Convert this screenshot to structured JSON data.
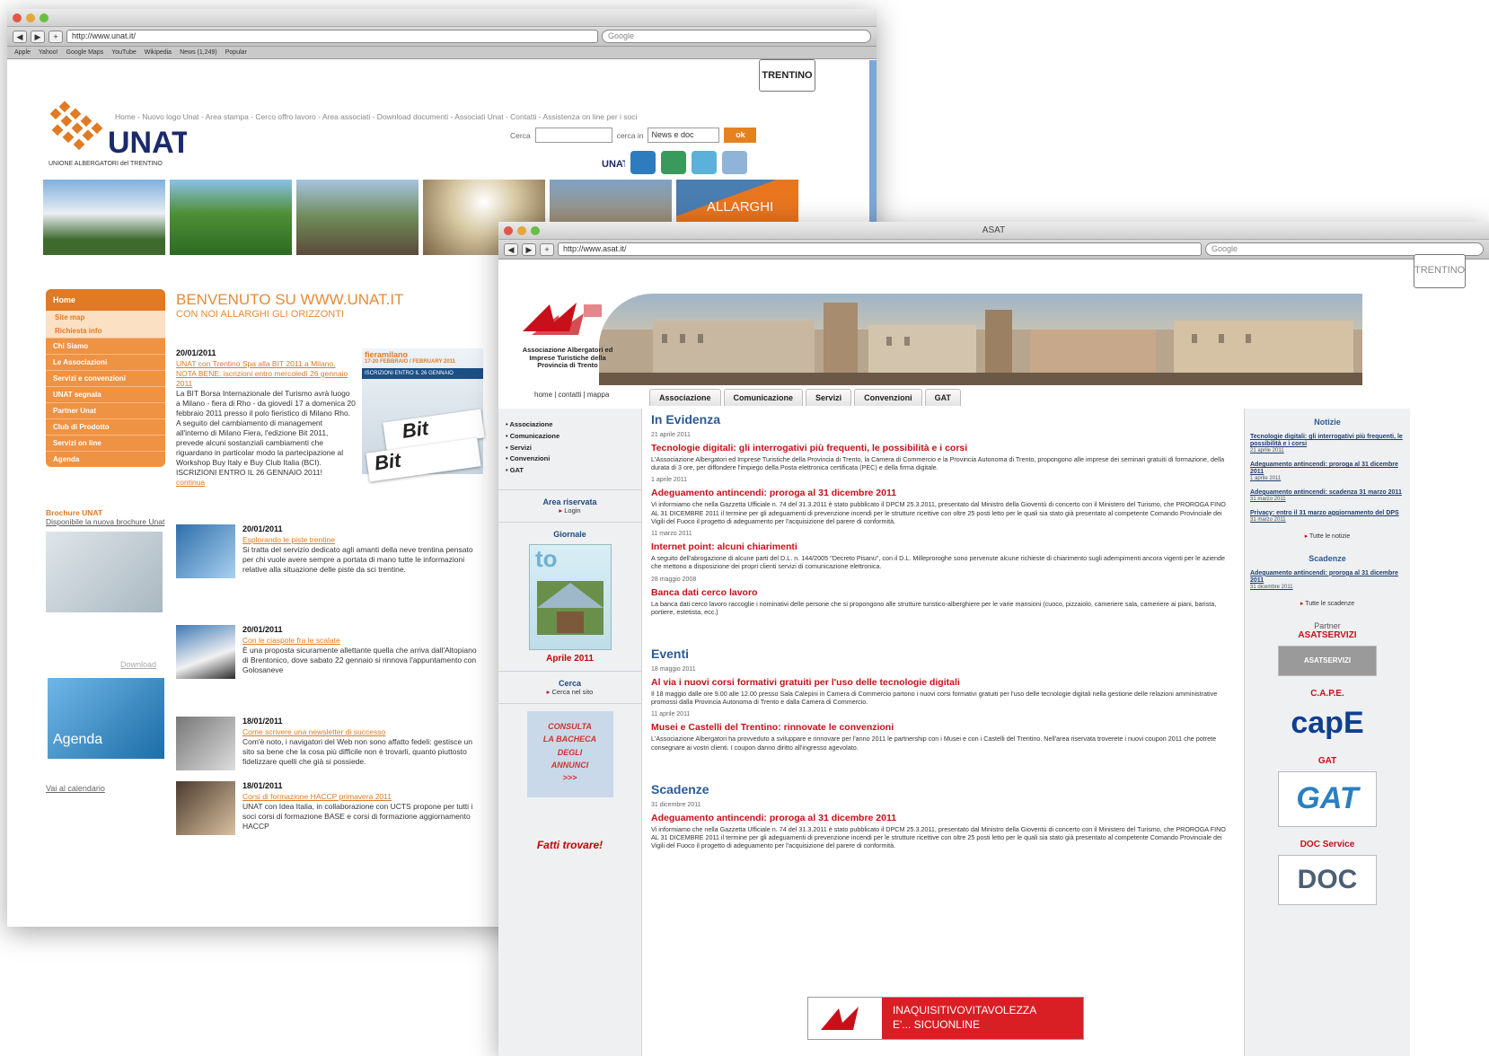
{
  "unat_window": {
    "url": "http://www.unat.it/",
    "search_placeholder": "Google",
    "bookmarks": [
      "Apple",
      "Yahoo!",
      "Google Maps",
      "YouTube",
      "Wikipedia",
      "News (1,249)",
      "Popular"
    ],
    "trentino_badge": "TRENTINO",
    "logo_text": "UNAT",
    "logo_subtitle": "UNIONE ALBERGATORI del TRENTINO",
    "top_nav": "Home - Nuovo logo Unat - Area stampa - Cerco offro lavoro - Area associati - Download documenti - Associati Unat - Contatti - Assistenza on line per i soci",
    "search_label": "Cerca",
    "search_in_label": "cerca in",
    "search_select": "News e doc",
    "search_button": "ok",
    "banner_text": "ALLARGHI",
    "left_nav": {
      "head": "Home",
      "subs": [
        "Site map",
        "Richiesta info"
      ],
      "items": [
        "Chi Siamo",
        "Le Associazioni",
        "Servizi e convenzioni",
        "UNAT segnala",
        "Partner Unat",
        "Club di Prodotto",
        "Servizi on line",
        "Agenda"
      ]
    },
    "welcome_title": "BENVENUTO SU WWW.UNAT.IT",
    "welcome_subtitle": "CON NOI ALLARGHI GLI ORIZZONTI",
    "news_main": {
      "date": "20/01/2011",
      "link": "UNAT con Trentino Spa alla BIT 2011 a Milano. NOTA BENE: iscrizioni entro mercoledì 26 gennaio 2011",
      "body": "La BIT Borsa Internazionale del Turismo avrà luogo a Milano - fiera di Rho - da giovedì 17 a domenica 20 febbraio 2011 presso il polo fieristico di Milano Rho. A seguito del cambiamento di management all'interno di Milano Fiera, l'edizione Bit 2011, prevede alcuni sostanziali cambiamenti che riguardano in particolar modo la partecipazione al Workshop Buy Italy e Buy Club Italia (BCI). ISCRIZIONI ENTRO IL 26 GENNAIO 2011!",
      "more": "continua"
    },
    "fiera": {
      "title": "fieramilano",
      "dates": "17-20 FEBBRAIO / FEBRUARY 2011",
      "bar": "ISCRIZIONI ENTRO IL 26 GENNAIO",
      "bit": "Bit"
    },
    "news": [
      {
        "date": "20/01/2011",
        "link": "Esplorando le piste trentine",
        "body": "Si tratta del servizio dedicato agli amanti della neve trentina pensato per chi vuole avere sempre a portata di mano tutte le informazioni relative alla situazione delle piste da sci trentine."
      },
      {
        "date": "20/01/2011",
        "link": "Con le ciaspole fra le scalate",
        "body": "È una proposta sicuramente allettante quella che arriva dall'Altopiano di Brentonico, dove sabato 22 gennaio si rinnova l'appuntamento con Golosaneve"
      },
      {
        "date": "18/01/2011",
        "link": "Come scrivere una newsletter di successo",
        "body": "Com'è noto, i navigatori del Web non sono affatto fedeli: gestisce un sito sa bene che la cosa più difficile non è trovarli, quanto piuttosto fidelizzare quelli che già si possiede."
      },
      {
        "date": "18/01/2011",
        "link": "Corsi di formazione HACCP primavera 2011",
        "body": "UNAT con Idea Italia, in collaborazione con UCTS propone per tutti i soci corsi di formazione BASE e corsi di formazione aggiornamento HACCP"
      }
    ],
    "brochure_title": "Brochure UNAT",
    "brochure_link": "Disponibile la nuova brochure Unat",
    "download": "Download",
    "agenda_label": "Agenda",
    "calendar_link": "Vai al calendario"
  },
  "asat_window": {
    "title": "ASAT",
    "url": "http://www.asat.it/",
    "search_placeholder": "Google",
    "trentino_badge": "TRENTINO",
    "logo_caption": "Associazione Albergatori ed Imprese Turistiche della Provincia di Trento",
    "home_links": "home | contatti | mappa",
    "tabs": [
      "Associazione",
      "Comunicazione",
      "Servizi",
      "Convenzioni",
      "GAT"
    ],
    "side_menu": [
      "Associazione",
      "Comunicazione",
      "Servizi",
      "Convenzioni",
      "GAT"
    ],
    "area_riservata": "Area riservata",
    "login": "Login",
    "giornale": "Giornale",
    "aprile": "Aprile 2011",
    "cerca": "Cerca",
    "cerca_link": "Cerca nel sito",
    "consulta": [
      "CONSULTA",
      "LA BACHECA",
      "DEGLI",
      "ANNUNCI",
      ">>>"
    ],
    "fatti": "Fatti trovare!",
    "in_evidenza": "In Evidenza",
    "evidenza": [
      {
        "date": "21 aprile 2011",
        "title": "Tecnologie digitali: gli interrogativi più frequenti, le possibilità e i corsi",
        "body": "L'Associazione Albergatori ed Imprese Turistiche della Provincia di Trento, la Camera di Commercio e la Provincia Autonoma di Trento, propongono alle imprese dei seminari gratuiti di formazione, della durata di 3 ore, per diffondere l'impiego della Posta elettronica certificata (PEC) e della firma digitale."
      },
      {
        "date": "1 aprile 2011",
        "title": "Adeguamento antincendi: proroga al 31 dicembre 2011",
        "body": "Vi informiamo che nella Gazzetta Ufficiale n. 74 del 31.3.2011 è stato pubblicato il DPCM 25.3.2011, presentato dal Ministro della Gioventù di concerto con il Ministero del Turismo, che PROROGA FINO AL 31 DICEMBRE 2011 il termine per gli adeguamenti di prevenzione incendi per le strutture ricettive con oltre 25 posti letto per le quali sia stato già presentato al competente Comando Provinciale dei Vigili del Fuoco il progetto di adeguamento per l'acquisizione del parere di conformità."
      },
      {
        "date": "11 marzo 2011",
        "title": "Internet point: alcuni chiarimenti",
        "body": "A seguito dell'abrogazione di alcune parti del D.L. n. 144/2005 \"Decreto Pisanu\", con il D.L. Milleproroghe sono pervenute alcune richieste di chiarimento sugli adempimenti ancora vigenti per le aziende che mettono a disposizione dei propri clienti servizi di comunicazione elettronica."
      },
      {
        "date": "28 maggio 2008",
        "title": "Banca dati cerco lavoro",
        "body": "La banca dati cerco lavoro raccoglie i nominativi delle persone che si propongono alle strutture turistico-alberghiere per le varie mansioni (cuoco, pizzaiolo, cameriere sala, cameriere ai piani, barista, portiere, estetista, ecc.)"
      }
    ],
    "eventi": "Eventi",
    "eventi_items": [
      {
        "date": "18 maggio 2011",
        "title": "Al via i nuovi corsi formativi gratuiti per l'uso delle tecnologie digitali",
        "body": "Il 18 maggio dalle ore 9.00 alle 12.00 presso Sala Calepini in Camera di Commercio partono i nuovi corsi formativi gratuiti per l'uso delle tecnologie digitali nella gestione delle relazioni amministrative promossi dalla Provincia Autonoma di Trento e dalla Camera di Commercio."
      },
      {
        "date": "11 aprile 2011",
        "title": "Musei e Castelli del Trentino: rinnovate le convenzioni",
        "body": "L'Associazione Albergatori ha provveduto a sviluppare e rinnovare per l'anno 2011 le partnership con i Musei e con i Castelli del Trentino. Nell'area riservata troverete i nuovi coupon 2011 che potrete consegnare ai vostri clienti. I coupon danno diritto all'ingresso agevolato."
      }
    ],
    "scadenze": "Scadenze",
    "scadenze_items": [
      {
        "date": "31 dicembre 2011",
        "title": "Adeguamento antincendi: proroga al 31 dicembre 2011",
        "body": "Vi informiamo che nella Gazzetta Ufficiale n. 74 del 31.3.2011 è stato pubblicato il DPCM 25.3.2011, presentato dal Ministro della Gioventù di concerto con il Ministero del Turismo, che PROROGA FINO AL 31 DICEMBRE 2011 il termine per gli adeguamenti di prevenzione incendi per le strutture ricettive con oltre 25 posti letto per le quali sia stato già presentato al competente Comando Provinciale dei Vigili del Fuoco il progetto di adeguamento per l'acquisizione del parere di conformità."
      }
    ],
    "banner_lines": [
      "INAQUISITIVOVITAVOLEZZA",
      "E'... SICUONLINE"
    ],
    "right": {
      "notizie": "Notizie",
      "notizie_items": [
        {
          "title": "Tecnologie digitali: gli interrogativi più frequenti, le possibilità e i corsi",
          "date": "21 aprile 2011"
        },
        {
          "title": "Adeguamento antincendi: proroga al 31 dicembre 2011",
          "date": "1 aprile 2011"
        },
        {
          "title": "Adeguamento antincendi: scadenza 31 marzo 2011",
          "date": "31 marzo 2011"
        },
        {
          "title": "Privacy: entro il 31 marzo aggiornamento del DPS",
          "date": "31 marzo 2011"
        }
      ],
      "tutte_notizie": "Tutte le notizie",
      "scadenze": "Scadenze",
      "scadenze_items": [
        {
          "title": "Adeguamento antincendi: proroga al 31 dicembre 2011",
          "date": "31 dicembre 2011"
        }
      ],
      "tutte_scadenze": "Tutte le scadenze",
      "partner": "Partner",
      "asatservizi": "ASATSERVIZI",
      "asatservizi_logo": "ASATSERVIZI",
      "cape": "C.A.P.E.",
      "cape_logo": "capE",
      "gat": "GAT",
      "gat_logo": "GAT",
      "doc": "DOC Service",
      "doc_logo": "DOC"
    }
  },
  "colors": {
    "unat_orange": "#e07a24",
    "asat_red": "#c8101a",
    "asat_blue": "#2a5b94"
  }
}
